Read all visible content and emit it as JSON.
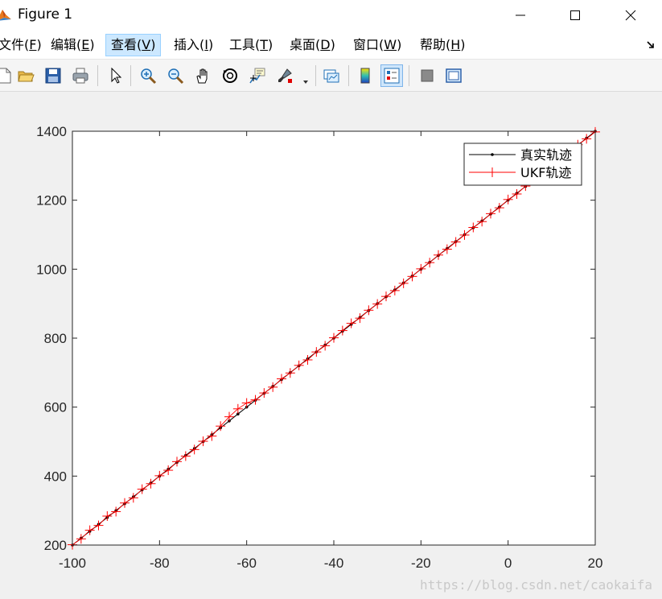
{
  "window": {
    "title": "Figure 1"
  },
  "menu": {
    "items": [
      {
        "label": "文件(",
        "key": "F",
        "tail": ")"
      },
      {
        "label": "编辑(",
        "key": "E",
        "tail": ")"
      },
      {
        "label": "查看(",
        "key": "V",
        "tail": ")"
      },
      {
        "label": "插入(",
        "key": "I",
        "tail": ")"
      },
      {
        "label": "工具(",
        "key": "T",
        "tail": ")"
      },
      {
        "label": "桌面(",
        "key": "D",
        "tail": ")"
      },
      {
        "label": "窗口(",
        "key": "W",
        "tail": ")"
      },
      {
        "label": "帮助(",
        "key": "H",
        "tail": ")"
      }
    ],
    "active_index": 2
  },
  "toolbar": {
    "icons": [
      "new-file-icon",
      "open-folder-icon",
      "save-icon",
      "print-icon",
      "pointer-icon",
      "zoom-in-icon",
      "zoom-out-icon",
      "pan-hand-icon",
      "rotate-3d-icon",
      "data-cursor-icon",
      "brush-icon",
      "link-plot-icon",
      "colorbar-icon",
      "legend-icon",
      "hide-plot-tools-icon",
      "show-plot-tools-icon"
    ]
  },
  "watermark": "https://blog.csdn.net/caokaifa",
  "colors": {
    "true_track": "#000000",
    "ukf_track": "#ff0000"
  },
  "chart_data": {
    "type": "line",
    "xlim": [
      -100,
      20
    ],
    "ylim": [
      200,
      1400
    ],
    "xticks": [
      -100,
      -80,
      -60,
      -40,
      -20,
      0,
      20
    ],
    "yticks": [
      200,
      400,
      600,
      800,
      1000,
      1200,
      1400
    ],
    "grid": false,
    "legend_position": "top-right",
    "series": [
      {
        "name": "真实轨迹",
        "marker": "dot",
        "x": [
          -100,
          -98,
          -96,
          -94,
          -92,
          -90,
          -88,
          -86,
          -84,
          -82,
          -80,
          -78,
          -76,
          -74,
          -72,
          -70,
          -68,
          -66,
          -64,
          -62,
          -60,
          -58,
          -56,
          -54,
          -52,
          -50,
          -48,
          -46,
          -44,
          -42,
          -40,
          -38,
          -36,
          -34,
          -32,
          -30,
          -28,
          -26,
          -24,
          -22,
          -20,
          -18,
          -16,
          -14,
          -12,
          -10,
          -8,
          -6,
          -4,
          -2,
          0,
          2,
          4,
          6,
          8,
          10,
          12,
          14,
          16,
          18,
          20
        ],
        "y": [
          200,
          220,
          240,
          260,
          280,
          300,
          320,
          340,
          360,
          380,
          400,
          420,
          440,
          460,
          480,
          500,
          520,
          540,
          560,
          580,
          600,
          620,
          640,
          660,
          680,
          700,
          720,
          740,
          760,
          780,
          800,
          820,
          840,
          860,
          880,
          900,
          920,
          940,
          960,
          980,
          1000,
          1020,
          1040,
          1060,
          1080,
          1100,
          1120,
          1140,
          1160,
          1180,
          1200,
          1220,
          1240,
          1260,
          1280,
          1300,
          1320,
          1340,
          1360,
          1380,
          1400
        ]
      },
      {
        "name": "UKF轨迹",
        "marker": "plus",
        "x": [
          -100,
          -98,
          -96,
          -94,
          -92,
          -90,
          -88,
          -86,
          -84,
          -82,
          -80,
          -78,
          -76,
          -74,
          -72,
          -70,
          -68,
          -66,
          -64,
          -62,
          -60,
          -58,
          -56,
          -54,
          -52,
          -50,
          -48,
          -46,
          -44,
          -42,
          -40,
          -38,
          -36,
          -34,
          -32,
          -30,
          -28,
          -26,
          -24,
          -22,
          -20,
          -18,
          -16,
          -14,
          -12,
          -10,
          -8,
          -6,
          -4,
          -2,
          0,
          2,
          4,
          6,
          8,
          10,
          12,
          14,
          16,
          18,
          20
        ],
        "y": [
          201,
          218,
          243,
          257,
          284,
          297,
          322,
          337,
          362,
          378,
          401,
          417,
          442,
          458,
          477,
          501,
          516,
          545,
          572,
          595,
          612,
          621,
          641,
          658,
          682,
          699,
          721,
          737,
          760,
          778,
          801,
          822,
          843,
          858,
          881,
          899,
          921,
          938,
          959,
          979,
          1001,
          1019,
          1041,
          1058,
          1079,
          1099,
          1121,
          1138,
          1161,
          1178,
          1202,
          1218,
          1241,
          1258,
          1281,
          1299,
          1321,
          1338,
          1361,
          1378,
          1398
        ]
      }
    ]
  }
}
